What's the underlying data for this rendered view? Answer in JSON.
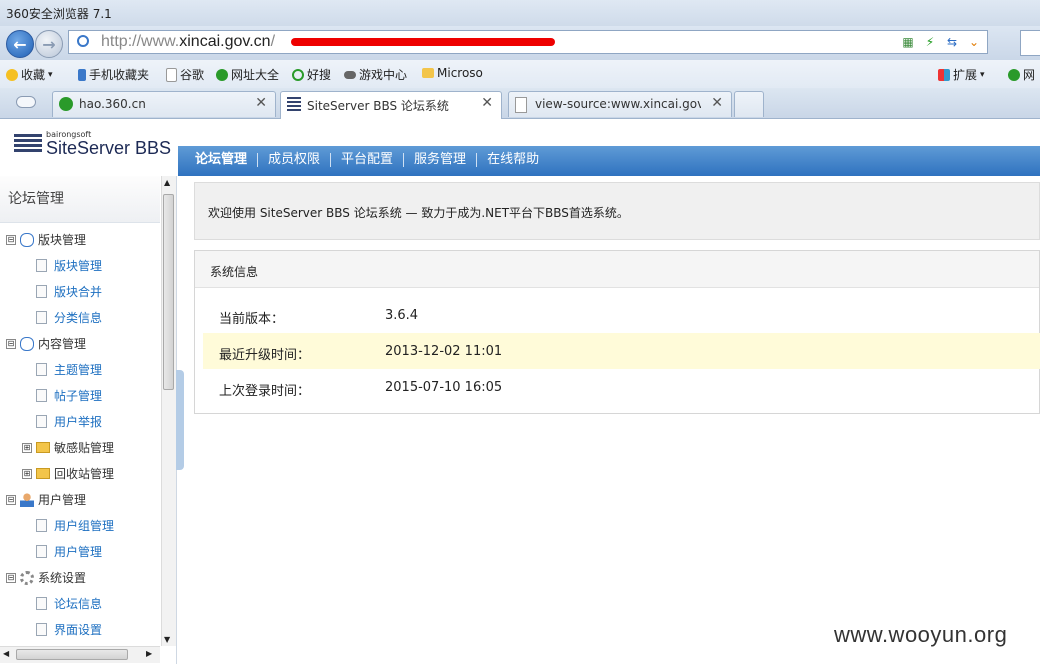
{
  "window": {
    "title": "360安全浏览器 7.1"
  },
  "address_bar": {
    "url_prefix": "http://www.",
    "url_host": "xincai.gov.cn",
    "url_rest": "/"
  },
  "favorites": [
    "收藏",
    "手机收藏夹",
    "谷歌",
    "网址大全",
    "好搜",
    "游戏中心",
    "Microso",
    "扩展",
    "网"
  ],
  "tabs": [
    {
      "label": "hao.360.cn"
    },
    {
      "label": "SiteServer BBS 论坛系统"
    },
    {
      "label": "view-source:www.xincai.gov.c"
    }
  ],
  "logo": {
    "small": "bairongsoft",
    "big": "SiteServer BBS"
  },
  "top_nav": [
    "论坛管理",
    "成员权限",
    "平台配置",
    "服务管理",
    "在线帮助"
  ],
  "sidebar": {
    "header": "论坛管理",
    "tree": [
      {
        "label": "版块管理",
        "type": "category",
        "toggle": "⊟"
      },
      {
        "label": "版块管理",
        "type": "leaf"
      },
      {
        "label": "版块合并",
        "type": "leaf"
      },
      {
        "label": "分类信息",
        "type": "leaf"
      },
      {
        "label": "内容管理",
        "type": "category",
        "toggle": "⊟"
      },
      {
        "label": "主题管理",
        "type": "leaf"
      },
      {
        "label": "帖子管理",
        "type": "leaf"
      },
      {
        "label": "用户举报",
        "type": "leaf"
      },
      {
        "label": "敏感贴管理",
        "type": "folder",
        "toggle": "⊞"
      },
      {
        "label": "回收站管理",
        "type": "folder",
        "toggle": "⊞"
      },
      {
        "label": "用户管理",
        "type": "category",
        "toggle": "⊟"
      },
      {
        "label": "用户组管理",
        "type": "leaf"
      },
      {
        "label": "用户管理",
        "type": "leaf"
      },
      {
        "label": "系统设置",
        "type": "category",
        "toggle": "⊟"
      },
      {
        "label": "论坛信息",
        "type": "leaf"
      },
      {
        "label": "界面设置",
        "type": "leaf"
      }
    ]
  },
  "welcome": "欢迎使用 SiteServer BBS 论坛系统 — 致力于成为.NET平台下BBS首选系统。",
  "system_info": {
    "title": "系统信息",
    "rows": [
      {
        "key": "当前版本：",
        "value": "3.6.4"
      },
      {
        "key": "最近升级时间：",
        "value": "2013-12-02 11:01"
      },
      {
        "key": "上次登录时间：",
        "value": "2015-07-10 16:05"
      }
    ]
  },
  "watermark": "www.wooyun.org"
}
